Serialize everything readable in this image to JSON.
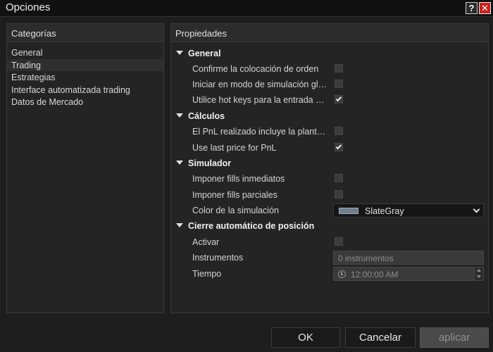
{
  "window": {
    "title": "Opciones",
    "help_label": "?",
    "close_label": "✕",
    "help_icon": "question-icon",
    "close_icon": "close-icon"
  },
  "left_panel": {
    "header": "Categorías",
    "items": [
      {
        "label": "General",
        "selected": false
      },
      {
        "label": "Trading",
        "selected": true
      },
      {
        "label": "Estrategias",
        "selected": false
      },
      {
        "label": "Interface automatizada trading",
        "selected": false
      },
      {
        "label": "Datos de Mercado",
        "selected": false
      }
    ]
  },
  "right_panel": {
    "header": "Propiedades",
    "sections": {
      "general": {
        "title": "General",
        "items": [
          {
            "label": "Confirme la colocación de orden",
            "checked": false
          },
          {
            "label": "Iniciar en modo de simulación global",
            "checked": false
          },
          {
            "label": "Utilice hot keys para la entrada de órdenes",
            "checked": true
          }
        ]
      },
      "calculos": {
        "title": "Cálculos",
        "items": [
          {
            "label": "El PnL realizado incluye la plantilla de comisiones",
            "checked": false
          },
          {
            "label": "Use last price for PnL",
            "checked": true
          }
        ]
      },
      "simulador": {
        "title": "Simulador",
        "items": [
          {
            "label": "Imponer fills inmediatos",
            "checked": false
          },
          {
            "label": "Imponer fills parciales",
            "checked": false
          }
        ],
        "color": {
          "label": "Color de la simulación",
          "value": "SlateGray",
          "swatch": "#708090"
        }
      },
      "cierre": {
        "title": "Cierre automático de posición",
        "activar": {
          "label": "Activar",
          "checked": false
        },
        "instrumentos": {
          "label": "Instrumentos",
          "value": "0 instrumentos"
        },
        "tiempo": {
          "label": "Tiempo",
          "value": "12:00:00 AM"
        }
      }
    }
  },
  "buttons": {
    "ok": "OK",
    "cancel": "Cancelar",
    "apply": "aplicar"
  },
  "colors": {
    "background": "#1e1e1e",
    "panel": "#242424",
    "close": "#c8211f",
    "disabled": "#4a4a4a"
  }
}
